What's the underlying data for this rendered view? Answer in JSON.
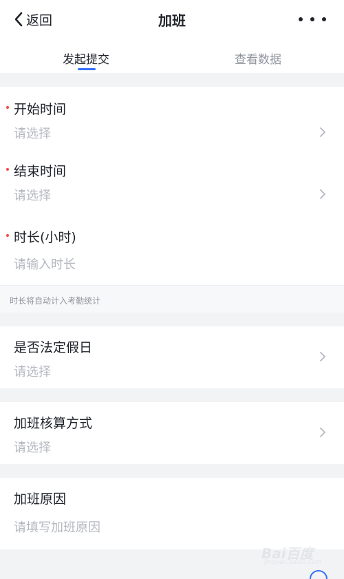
{
  "navbar": {
    "back_label": "返回",
    "title": "加班"
  },
  "tabs": [
    {
      "label": "发起提交",
      "active": true
    },
    {
      "label": "查看数据",
      "active": false
    }
  ],
  "fields": {
    "start_time": {
      "label": "开始时间",
      "value": "请选择",
      "required": true
    },
    "end_time": {
      "label": "结束时间",
      "value": "请选择",
      "required": true
    },
    "duration": {
      "label": "时长(小时)",
      "placeholder": "请输入时长",
      "required": true
    },
    "duration_hint": "时长将自动计入考勤统计",
    "holiday": {
      "label": "是否法定假日",
      "value": "请选择"
    },
    "calc_method": {
      "label": "加班核算方式",
      "value": "请选择"
    },
    "reason": {
      "label": "加班原因",
      "placeholder": "请填写加班原因"
    }
  },
  "watermark": {
    "text": "Bai百度",
    "sub": "jingyan.baidu.com"
  },
  "colors": {
    "accent": "#3370ff",
    "required": "#f54a45",
    "placeholder": "#b4b8bf",
    "background": "#f2f3f5"
  },
  "icons": {
    "back": "chevron-left-icon",
    "more": "more-dots-icon",
    "row": "chevron-right-icon"
  }
}
